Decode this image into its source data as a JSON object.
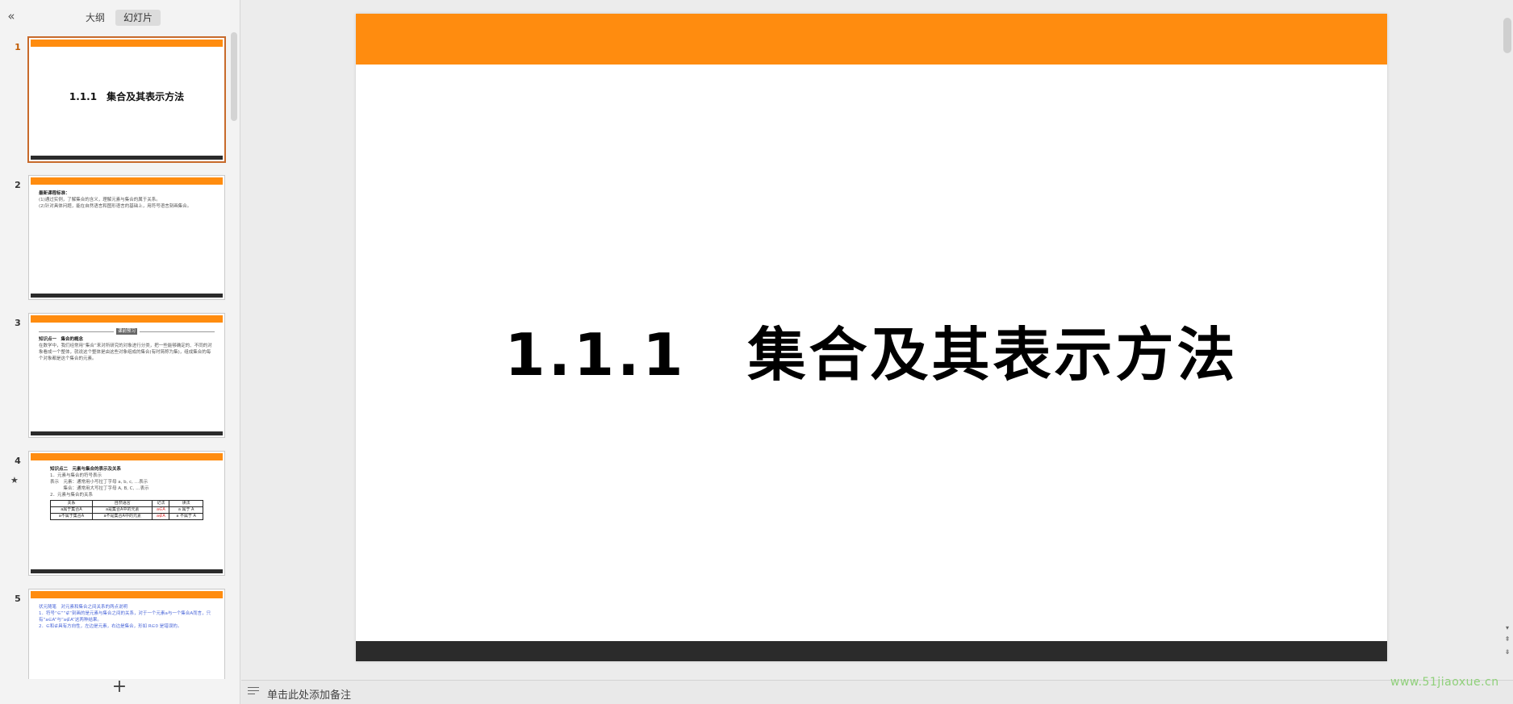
{
  "sidebar": {
    "collapse_icon": "«",
    "tabs": {
      "outline": "大纲",
      "slides": "幻灯片"
    },
    "add_icon": "+"
  },
  "thumbnails": [
    {
      "number": "1",
      "title": "1.1.1　集合及其表示方法"
    },
    {
      "number": "2",
      "lines": [
        "最新课程标准：",
        "(1)通过实例，了解集合的含义，理解元素与集合的属于关系。",
        "(2)针对具体问题，能在自然语言和图形语言的基础上，用符号语言刻画集合。"
      ]
    },
    {
      "number": "3",
      "banner": "课前预习",
      "lines": [
        "知识点一　集合的概念",
        "在数学中，我们经常用“集合”来对所研究的对象进行分类，把一些能够确定的、不同的对象看成一个整体，就说这个整体是由这些对象组成的集合(有时简称为集)，组成集合的每个对象都是这个集合的元素。"
      ]
    },
    {
      "number": "4",
      "star": "★",
      "lines": [
        "知识点二　元素与集合的表示及关系",
        "1．元素与集合的符号表示",
        "表示　元素：通常用小写拉丁字母 a, b, c, …表示",
        "　　　集合：通常用大写拉丁字母 A, B, C, …表示",
        "2．元素与集合的关系"
      ],
      "table": [
        [
          "关系",
          "自然语言",
          "记法",
          "读法"
        ],
        [
          "a属于集合A",
          "a是集合A中的元素",
          "a∈A",
          "a 属于 A"
        ],
        [
          "a不属于集合A",
          "a不是集合A中的元素",
          "a∉A",
          "a 不属于 A"
        ]
      ]
    },
    {
      "number": "5",
      "lines": [
        "状元随笔　对元素和集合之间关系的两点说明",
        "1．符号“∈”“∉”刻画的是元素与集合之间的关系，对于一个元素a与一个集合A而言，只有“a∈A”与“a∉A”这两种结果。",
        "2．∈和∉具有方向性，左边是元素，右边是集合，形如 R∈0 是错误的。"
      ]
    }
  ],
  "slide": {
    "title": "1.1.1　集合及其表示方法"
  },
  "notes": {
    "placeholder": "单击此处添加备注"
  },
  "watermark": "www.51jiaoxue.cn",
  "colors": {
    "accent": "#ff8c0f",
    "footer": "#2b2b2b",
    "active_border": "#c76a2b"
  }
}
